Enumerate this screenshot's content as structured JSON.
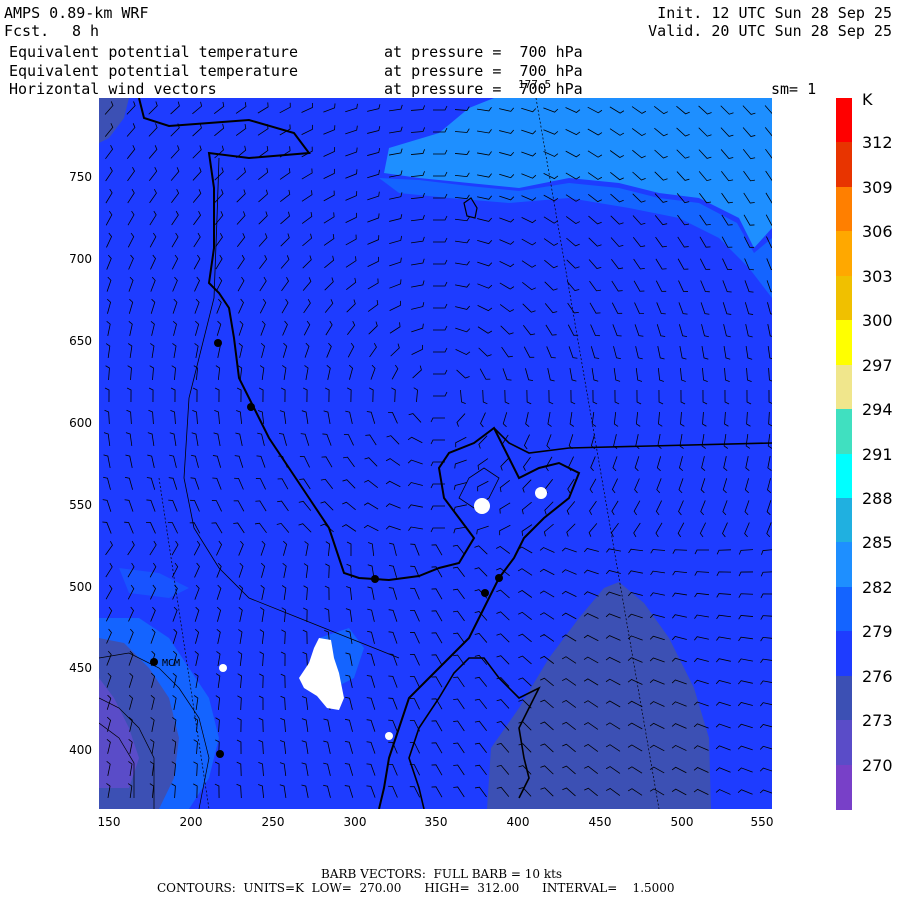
{
  "header": {
    "model": "AMPS 0.89-km WRF",
    "fcst_label": "Fcst.",
    "fcst_value": "8 h",
    "init": "Init. 12 UTC Sun 28 Sep 25",
    "valid": "Valid. 20 UTC Sun 28 Sep 25",
    "line1_field": "Equivalent potential temperature",
    "line1_level": "at pressure =  700 hPa",
    "line2_field": "Equivalent potential temperature",
    "line2_level": "at pressure =  700 hPa",
    "line3_field": "Horizontal wind vectors",
    "line3_level": "at pressure =  700 hPa",
    "line3_overlay": "177.5",
    "sm": "sm= 1"
  },
  "axes": {
    "x_ticks": [
      "150",
      "200",
      "250",
      "300",
      "350",
      "400",
      "450",
      "500",
      "550"
    ],
    "y_ticks": [
      "750",
      "700",
      "650",
      "600",
      "550",
      "500",
      "450",
      "400"
    ]
  },
  "colorbar": {
    "unit": "K",
    "labels": [
      "312",
      "309",
      "306",
      "303",
      "300",
      "297",
      "294",
      "291",
      "288",
      "285",
      "282",
      "279",
      "276",
      "273",
      "270"
    ],
    "colors": [
      "#ff0000",
      "#e83400",
      "#ff7f00",
      "#ffa800",
      "#f0c000",
      "#ffff00",
      "#f0e68c",
      "#40e0c0",
      "#00ffff",
      "#20b0e0",
      "#1e8fff",
      "#1464ff",
      "#1e3cff",
      "#3c50b4",
      "#5a4cc8",
      "#7840c8"
    ]
  },
  "map": {
    "colors": {
      "k276": "#1e3cff",
      "k279": "#1464ff",
      "k282": "#1e8fff",
      "k273": "#3c50b4",
      "k270": "#5a4cc8"
    },
    "station_label": "MCM"
  },
  "footer": {
    "barb": "BARB VECTORS:  FULL BARB = 10 kts",
    "contours": "CONTOURS:  UNITS=K  LOW=  270.00      HIGH=  312.00      INTERVAL=    1.5000"
  }
}
